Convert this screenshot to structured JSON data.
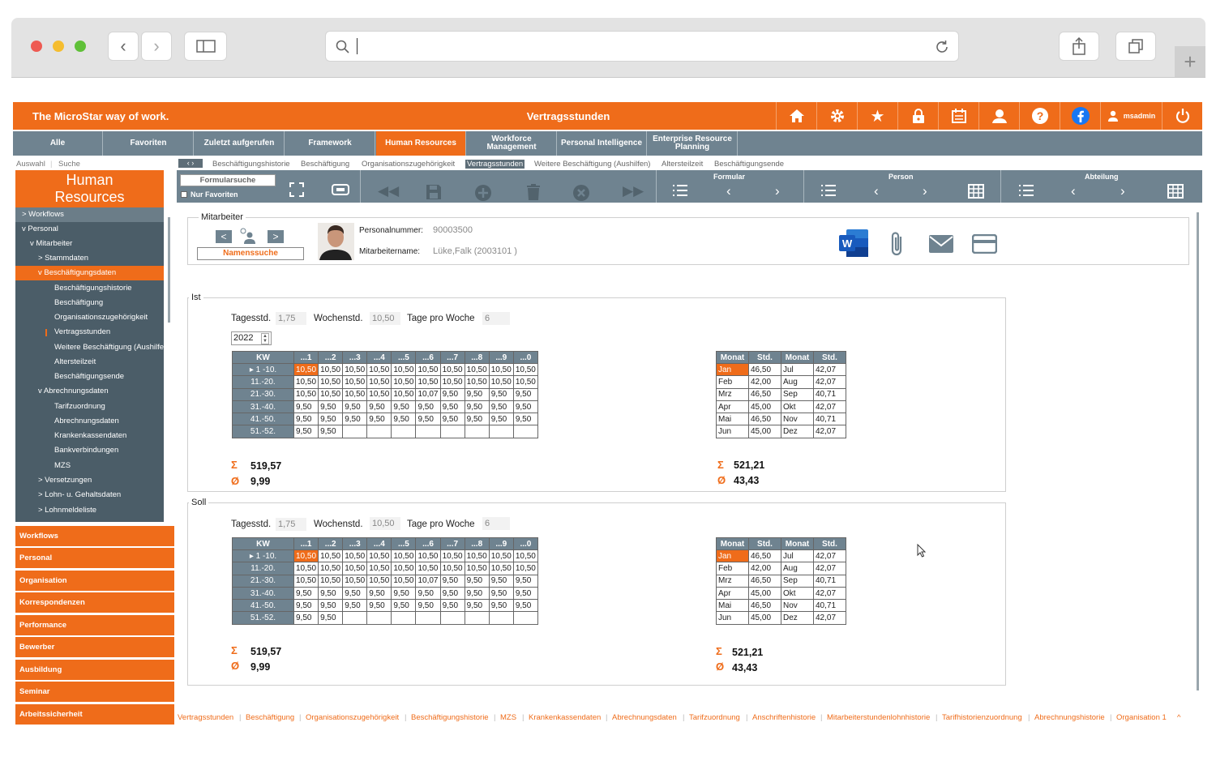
{
  "app": {
    "brand": "The MicroStar way of work.",
    "title": "Vertragsstunden",
    "user": "msadmin"
  },
  "nav_tabs": [
    "Alle",
    "Favoriten",
    "Zuletzt aufgerufen",
    "Framework",
    "Human Resources",
    "Workforce Management",
    "Personal Intelligence",
    "Enterprise Resource Planning"
  ],
  "sub": {
    "auswahl": "Auswahl",
    "suche": "Suche"
  },
  "breadcrumb": [
    "Beschäftigungshistorie",
    "Beschäftigung",
    "Organisationszugehörigkeit",
    "Vertragsstunden",
    "Weitere Beschäftigung (Aushilfen)",
    "Altersteilzeit",
    "Beschäftigungsende"
  ],
  "left": {
    "title_line1": "Human",
    "title_line2": "Resources",
    "tree": [
      {
        "label": "> Workflows"
      },
      {
        "label": "v Personal"
      },
      {
        "label": "v Mitarbeiter"
      },
      {
        "label": "> Stammdaten"
      },
      {
        "label": "v Beschäftigungsdaten"
      },
      {
        "label": "Beschäftigungshistorie"
      },
      {
        "label": "Beschäftigung"
      },
      {
        "label": "Organisationszugehörigkeit"
      },
      {
        "label": "Vertragsstunden"
      },
      {
        "label": "Weitere Beschäftigung (Aushilfen)"
      },
      {
        "label": "Altersteilzeit"
      },
      {
        "label": "Beschäftigungsende"
      },
      {
        "label": "v Abrechnungsdaten"
      },
      {
        "label": "Tarifzuordnung"
      },
      {
        "label": "Abrechnungsdaten"
      },
      {
        "label": "Krankenkassendaten"
      },
      {
        "label": "Bankverbindungen"
      },
      {
        "label": "MZS"
      },
      {
        "label": "> Versetzungen"
      },
      {
        "label": "> Lohn- u. Gehaltsdaten"
      },
      {
        "label": "> Lohnmeldeliste"
      }
    ],
    "modules": [
      "Workflows",
      "Personal",
      "Organisation",
      "Korrespondenzen",
      "Performance",
      "Bewerber",
      "Ausbildung",
      "Seminar",
      "Arbeitssicherheit"
    ]
  },
  "toolbar": {
    "formularsuche": "Formularsuche",
    "nur_favoriten": "Nur Favoriten",
    "formular": "Formular",
    "person": "Person",
    "abteilung": "Abteilung"
  },
  "employee": {
    "section": "Mitarbeiter",
    "namenssuche": "Namenssuche",
    "pnr_label": "Personalnummer:",
    "pnr": "90003500",
    "name_label": "Mitarbeitername:",
    "name": "Lüke,Falk (2003101 )"
  },
  "ist": {
    "title": "Ist",
    "tages_label": "Tagesstd.",
    "tages": "1,75",
    "wochen_label": "Wochenstd.",
    "wochen": "10,50",
    "tage_label": "Tage pro Woche",
    "tage": "6",
    "year": "2022",
    "sum": "519,57",
    "avg": "9,99",
    "sum_m": "521,21",
    "avg_m": "43,43"
  },
  "soll": {
    "title": "Soll",
    "tages_label": "Tagesstd.",
    "tages": "1,75",
    "wochen_label": "Wochenstd.",
    "wochen": "10,50",
    "tage_label": "Tage pro Woche",
    "tage": "6",
    "sum": "519,57",
    "avg": "9,99",
    "sum_m": "521,21",
    "avg_m": "43,43"
  },
  "kw_table": {
    "headers": [
      "KW",
      "...1",
      "...2",
      "...3",
      "...4",
      "...5",
      "...6",
      "...7",
      "...8",
      "...9",
      "...0"
    ],
    "rows": [
      [
        "1 -10.",
        "10,50",
        "10,50",
        "10,50",
        "10,50",
        "10,50",
        "10,50",
        "10,50",
        "10,50",
        "10,50",
        "10,50"
      ],
      [
        "11.-20.",
        "10,50",
        "10,50",
        "10,50",
        "10,50",
        "10,50",
        "10,50",
        "10,50",
        "10,50",
        "10,50",
        "10,50"
      ],
      [
        "21.-30.",
        "10,50",
        "10,50",
        "10,50",
        "10,50",
        "10,50",
        "10,07",
        "9,50",
        "9,50",
        "9,50",
        "9,50"
      ],
      [
        "31.-40.",
        "9,50",
        "9,50",
        "9,50",
        "9,50",
        "9,50",
        "9,50",
        "9,50",
        "9,50",
        "9,50",
        "9,50"
      ],
      [
        "41.-50.",
        "9,50",
        "9,50",
        "9,50",
        "9,50",
        "9,50",
        "9,50",
        "9,50",
        "9,50",
        "9,50",
        "9,50"
      ],
      [
        "51.-52.",
        "9,50",
        "9,50",
        "",
        "",
        "",
        "",
        "",
        "",
        "",
        ""
      ]
    ]
  },
  "month_table": {
    "headers": [
      "Monat",
      "Std.",
      "Monat",
      "Std."
    ],
    "rows": [
      [
        "Jan",
        "46,50",
        "Jul",
        "42,07"
      ],
      [
        "Feb",
        "42,00",
        "Aug",
        "42,07"
      ],
      [
        "Mrz",
        "46,50",
        "Sep",
        "40,71"
      ],
      [
        "Apr",
        "45,00",
        "Okt",
        "42,07"
      ],
      [
        "Mai",
        "46,50",
        "Nov",
        "40,71"
      ],
      [
        "Jun",
        "45,00",
        "Dez",
        "42,07"
      ]
    ]
  },
  "bottom_links": [
    "Vertragsstunden",
    "Beschäftigung",
    "Organisationszugehörigkeit",
    "Beschäftigungshistorie",
    "MZS",
    "Krankenkassendaten",
    "Abrechnungsdaten",
    "Tarifzuordnung",
    "Anschriftenhistorie",
    "Mitarbeiterstundenlohnhistorie",
    "Tarifhistorienzuordnung",
    "Abrechnungshistorie",
    "Organisation 1"
  ],
  "colors": {
    "accent": "#ef6c1a",
    "nav": "#6f8390",
    "tree": "#4b5d68"
  },
  "icons": [
    "home-icon",
    "gear-icon",
    "star-icon",
    "lock-icon",
    "calendar-icon",
    "user-support-icon",
    "help-icon",
    "facebook-icon",
    "user-icon",
    "power-icon"
  ]
}
